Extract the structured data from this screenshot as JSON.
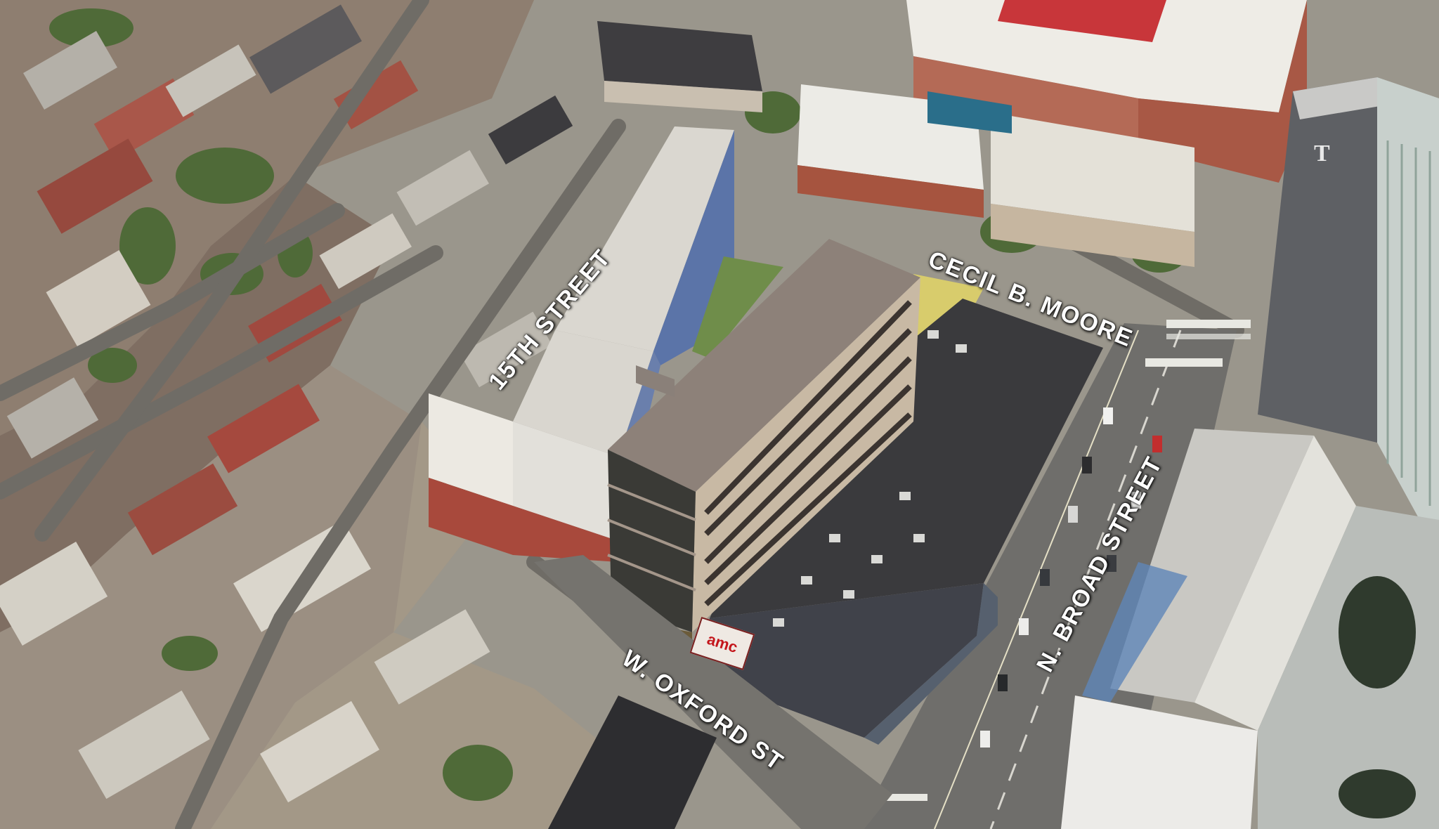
{
  "map": {
    "view": "aerial-3d",
    "streets": {
      "fifteenth": "15TH STREET",
      "cecil": "CECIL B. MOORE",
      "broad": "N. BROAD STREET",
      "oxford": "W. OXFORD ST"
    },
    "signage": {
      "cinema": "amc",
      "university_mark": "T"
    },
    "colors": {
      "proposed_building": "#8d8179",
      "rooftop_dark": "#3a3a3d",
      "park_green": "#6f8d4a",
      "yellow_plaza": "#d8cc6c",
      "arena_red_roof": "#c8363a",
      "street_label": "#ffffff"
    }
  }
}
